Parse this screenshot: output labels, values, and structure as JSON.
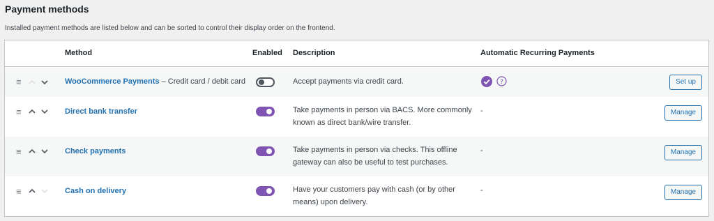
{
  "page": {
    "title": "Payment methods",
    "subtitle": "Installed payment methods are listed below and can be sorted to control their display order on the frontend."
  },
  "table": {
    "headers": {
      "method": "Method",
      "enabled": "Enabled",
      "description": "Description",
      "recurring": "Automatic Recurring Payments"
    },
    "rows": [
      {
        "name": "WooCommerce Payments",
        "suffix": " – Credit card / debit card",
        "enabled": false,
        "description": "Accept payments via credit card.",
        "recurring": "",
        "recurring_icons": [
          "check-circle-icon",
          "help-circle-icon"
        ],
        "button": "Set up",
        "up_enabled": false,
        "down_enabled": true
      },
      {
        "name": "Direct bank transfer",
        "suffix": "",
        "enabled": true,
        "description": "Take payments in person via BACS. More commonly known as direct bank/wire transfer.",
        "recurring": "-",
        "button": "Manage",
        "up_enabled": true,
        "down_enabled": true
      },
      {
        "name": "Check payments",
        "suffix": "",
        "enabled": true,
        "description": "Take payments in person via checks. This offline gateway can also be useful to test purchases.",
        "recurring": "-",
        "button": "Manage",
        "up_enabled": true,
        "down_enabled": true
      },
      {
        "name": "Cash on delivery",
        "suffix": "",
        "enabled": true,
        "description": "Have your customers pay with cash (or by other means) upon delivery.",
        "recurring": "-",
        "button": "Manage",
        "up_enabled": true,
        "down_enabled": false
      }
    ]
  },
  "colors": {
    "accent": "#7f54b3",
    "link": "#2271b1",
    "chevron_disabled": "#dcdcde",
    "chevron_enabled": "#50575e"
  },
  "icons": {
    "handle": "≡"
  }
}
